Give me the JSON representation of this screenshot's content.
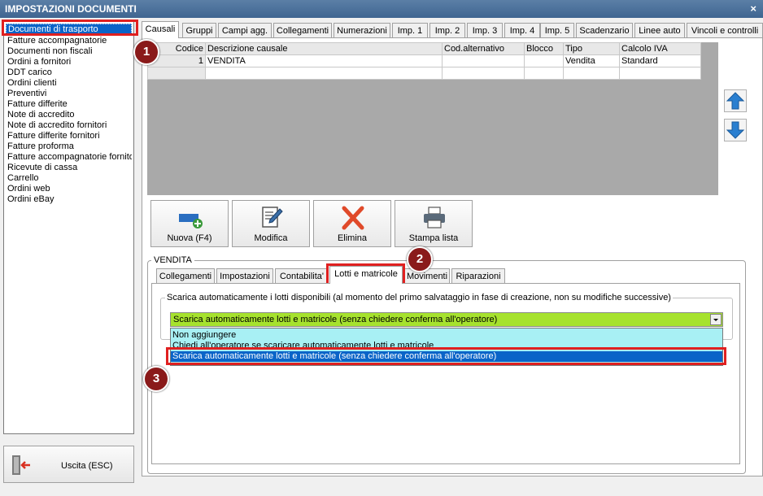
{
  "window": {
    "title": "IMPOSTAZIONI DOCUMENTI",
    "close_glyph": "×"
  },
  "sidebar": {
    "items": [
      "Documenti di trasporto",
      "Fatture accompagnatorie",
      "Documenti non fiscali",
      "Ordini a fornitori",
      "DDT carico",
      "Ordini clienti",
      "Preventivi",
      "Fatture differite",
      "Note di accredito",
      "Note di accredito fornitori",
      "Fatture differite fornitori",
      "Fatture proforma",
      "Fatture accompagnatorie fornito",
      "Ricevute di cassa",
      "Carrello",
      "Ordini web",
      "Ordini eBay"
    ],
    "selected_index": 0
  },
  "exit_button": {
    "label": "Uscita (ESC)",
    "icon": "exit-door-icon"
  },
  "top_tabs": [
    "Causali",
    "Gruppi",
    "Campi agg.",
    "Collegamenti",
    "Numerazioni",
    "Imp. 1",
    "Imp. 2",
    "Imp. 3",
    "Imp. 4",
    "Imp. 5",
    "Scadenzario",
    "Linee auto",
    "Vincoli e controlli"
  ],
  "top_tabs_active": "Causali",
  "grid": {
    "columns": [
      "Codice",
      "Descrizione causale",
      "Cod.alternativo",
      "Blocco",
      "Tipo",
      "Calcolo IVA"
    ],
    "rows": [
      [
        "1",
        "VENDITA",
        "",
        "",
        "Vendita",
        "Standard"
      ]
    ]
  },
  "actions": {
    "new": "Nuova (F4)",
    "edit": "Modifica",
    "delete": "Elimina",
    "print": "Stampa lista"
  },
  "group": {
    "legend": "VENDITA",
    "tabs": [
      "Collegamenti",
      "Impostazioni",
      "Contabilita'",
      "Lotti e matricole",
      "Movimenti",
      "Riparazioni"
    ],
    "active_tab": "Lotti e matricole",
    "lotti": {
      "legend": "Scarica automaticamente i lotti disponibili (al momento del primo salvataggio in fase di creazione, non su modifiche successive)",
      "selected": "Scarica automaticamente lotti e matricole (senza chiedere conferma all'operatore)",
      "options": [
        "Non aggiungere",
        "Chiedi all'operatore se scaricare automaticamente lotti e matricole",
        "Scarica automaticamente lotti e matricole (senza chiedere conferma all'operatore)"
      ]
    }
  },
  "badges": [
    "1",
    "2",
    "3"
  ],
  "colors": {
    "accent": "#0a64c8",
    "highlight_red": "#e02020",
    "combo_green": "#a6e22e",
    "list_cyan": "#a8f0f4",
    "badge": "#8a1a1a"
  }
}
